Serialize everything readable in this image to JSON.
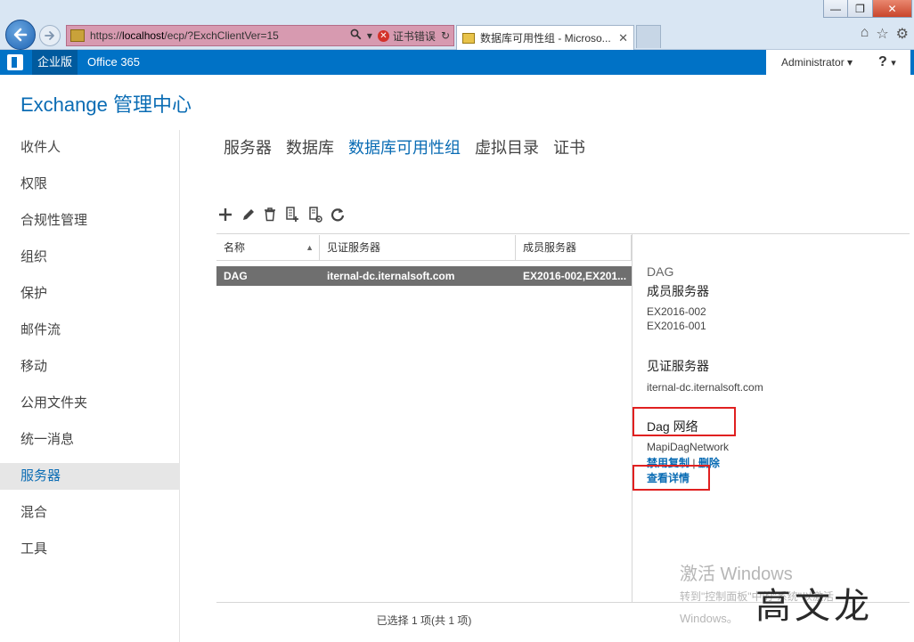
{
  "browser": {
    "url_scheme": "https://",
    "url_host": "localhost",
    "url_path": "/ecp/?ExchClientVer=15",
    "cert_error": "证书错误",
    "tab_title": "数据库可用性组 - Microso...",
    "search_icon": "search-icon",
    "dropdown_icon": "chevron-down-icon",
    "refresh_icon": "refresh-icon",
    "tab_close": "✕"
  },
  "window": {
    "minimize": "—",
    "restore": "❐",
    "close": "✕"
  },
  "office_bar": {
    "enterprise": "企业版",
    "office365": "Office 365",
    "user": "Administrator",
    "help": "?"
  },
  "app": {
    "title": "Exchange 管理中心"
  },
  "sidebar": {
    "items": [
      {
        "label": "收件人"
      },
      {
        "label": "权限"
      },
      {
        "label": "合规性管理"
      },
      {
        "label": "组织"
      },
      {
        "label": "保护"
      },
      {
        "label": "邮件流"
      },
      {
        "label": "移动"
      },
      {
        "label": "公用文件夹"
      },
      {
        "label": "统一消息"
      },
      {
        "label": "服务器",
        "selected": true
      },
      {
        "label": "混合"
      },
      {
        "label": "工具"
      }
    ]
  },
  "tabs": [
    {
      "label": "服务器"
    },
    {
      "label": "数据库"
    },
    {
      "label": "数据库可用性组",
      "active": true
    },
    {
      "label": "虚拟目录"
    },
    {
      "label": "证书"
    }
  ],
  "toolbar": {
    "buttons": [
      "add-icon",
      "edit-icon",
      "delete-icon",
      "manage-members-icon",
      "configure-network-icon",
      "refresh-icon"
    ]
  },
  "list": {
    "columns": [
      "名称",
      "见证服务器",
      "成员服务器"
    ],
    "sort_indicator": "▲",
    "rows": [
      {
        "name": "DAG",
        "witness": "iternal-dc.iternalsoft.com",
        "members": "EX2016-002,EX201..."
      }
    ],
    "status": "已选择 1 项(共 1 项)"
  },
  "details": {
    "name": "DAG",
    "members_heading": "成员服务器",
    "members": [
      "EX2016-002",
      "EX2016-001"
    ],
    "witness_heading": "见证服务器",
    "witness": "iternal-dc.iternalsoft.com",
    "network_heading": "Dag 网络",
    "network_name": "MapiDagNetwork",
    "disable_replication": "禁用复制",
    "separator": "|",
    "delete": "删除",
    "view_details": "查看详情"
  },
  "watermark": {
    "activate_title": "激活 Windows",
    "activate_line2": "转到\"控制面板\"中的\"系统\"以激活",
    "activate_line3": "Windows。",
    "signature": "高文龙"
  },
  "colors": {
    "accent": "#0a6cb4",
    "office_bar": "#0072c6",
    "selection_row": "#6f6f6f",
    "highlight": "#e02020"
  }
}
